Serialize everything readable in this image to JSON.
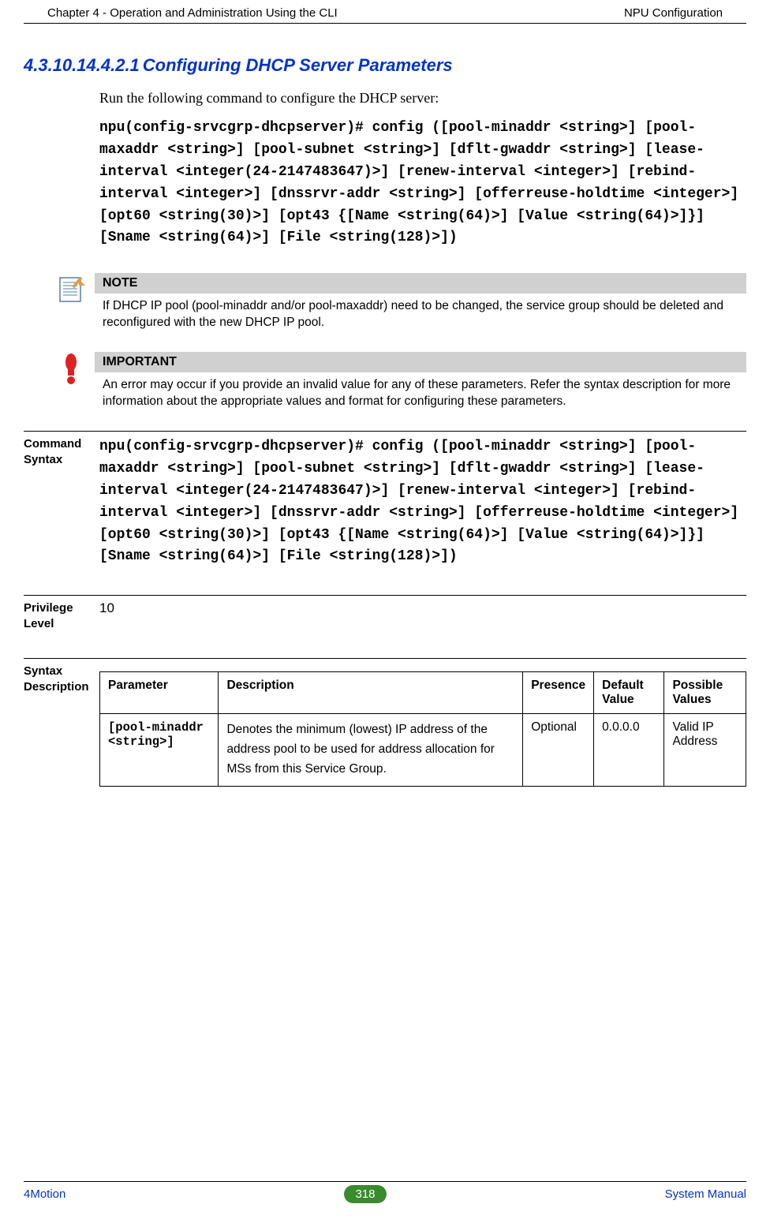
{
  "header": {
    "left": "Chapter 4 - Operation and Administration Using the CLI",
    "right": "NPU Configuration"
  },
  "section": {
    "number": "4.3.10.14.4.2.1",
    "title": "Configuring DHCP Server Parameters"
  },
  "intro": "Run the following command to configure the DHCP server:",
  "command_code": "npu(config-srvcgrp-dhcpserver)# config ([pool-minaddr <string>] [pool-maxaddr <string>] [pool-subnet <string>] [dflt-gwaddr <string>] [lease-interval <integer(24-2147483647)>] [renew-interval <integer>] [rebind-interval <integer>] [dnssrvr-addr <string>] [offerreuse-holdtime <integer>] [opt60 <string(30)>] [opt43 {[Name <string(64)>] [Value <string(64)>]}] [Sname <string(64)>] [File <string(128)>])",
  "note": {
    "title": "NOTE",
    "text": "If DHCP IP pool (pool-minaddr and/or pool-maxaddr) need to be changed, the service group should be deleted and reconfigured with the new DHCP IP pool."
  },
  "important": {
    "title": "IMPORTANT",
    "text": "An error may occur if you provide an invalid value for any of these parameters. Refer the syntax description for more information about the appropriate values and format for configuring these parameters."
  },
  "defs": {
    "command_syntax_label": "Command Syntax",
    "command_syntax_code": "npu(config-srvcgrp-dhcpserver)# config ([pool-minaddr <string>] [pool-maxaddr <string>] [pool-subnet <string>] [dflt-gwaddr <string>] [lease-interval <integer(24-2147483647)>] [renew-interval <integer>] [rebind-interval <integer>] [dnssrvr-addr <string>] [offerreuse-holdtime <integer>] [opt60 <string(30)>] [opt43 {[Name <string(64)>] [Value <string(64)>]}] [Sname <string(64)>] [File <string(128)>])",
    "privilege_label": "Privilege Level",
    "privilege_value": "10",
    "syntax_desc_label": "Syntax Description"
  },
  "table": {
    "headers": {
      "parameter": "Parameter",
      "description": "Description",
      "presence": "Presence",
      "default": "Default Value",
      "possible": "Possible Values"
    },
    "rows": [
      {
        "parameter": "[pool-minaddr <string>]",
        "description": "Denotes the minimum (lowest) IP address of the address pool to be used for address allocation for MSs from this Service Group.",
        "presence": "Optional",
        "default": "0.0.0.0",
        "possible": "Valid IP Address"
      }
    ]
  },
  "footer": {
    "left": "4Motion",
    "page": "318",
    "right": "System Manual"
  }
}
